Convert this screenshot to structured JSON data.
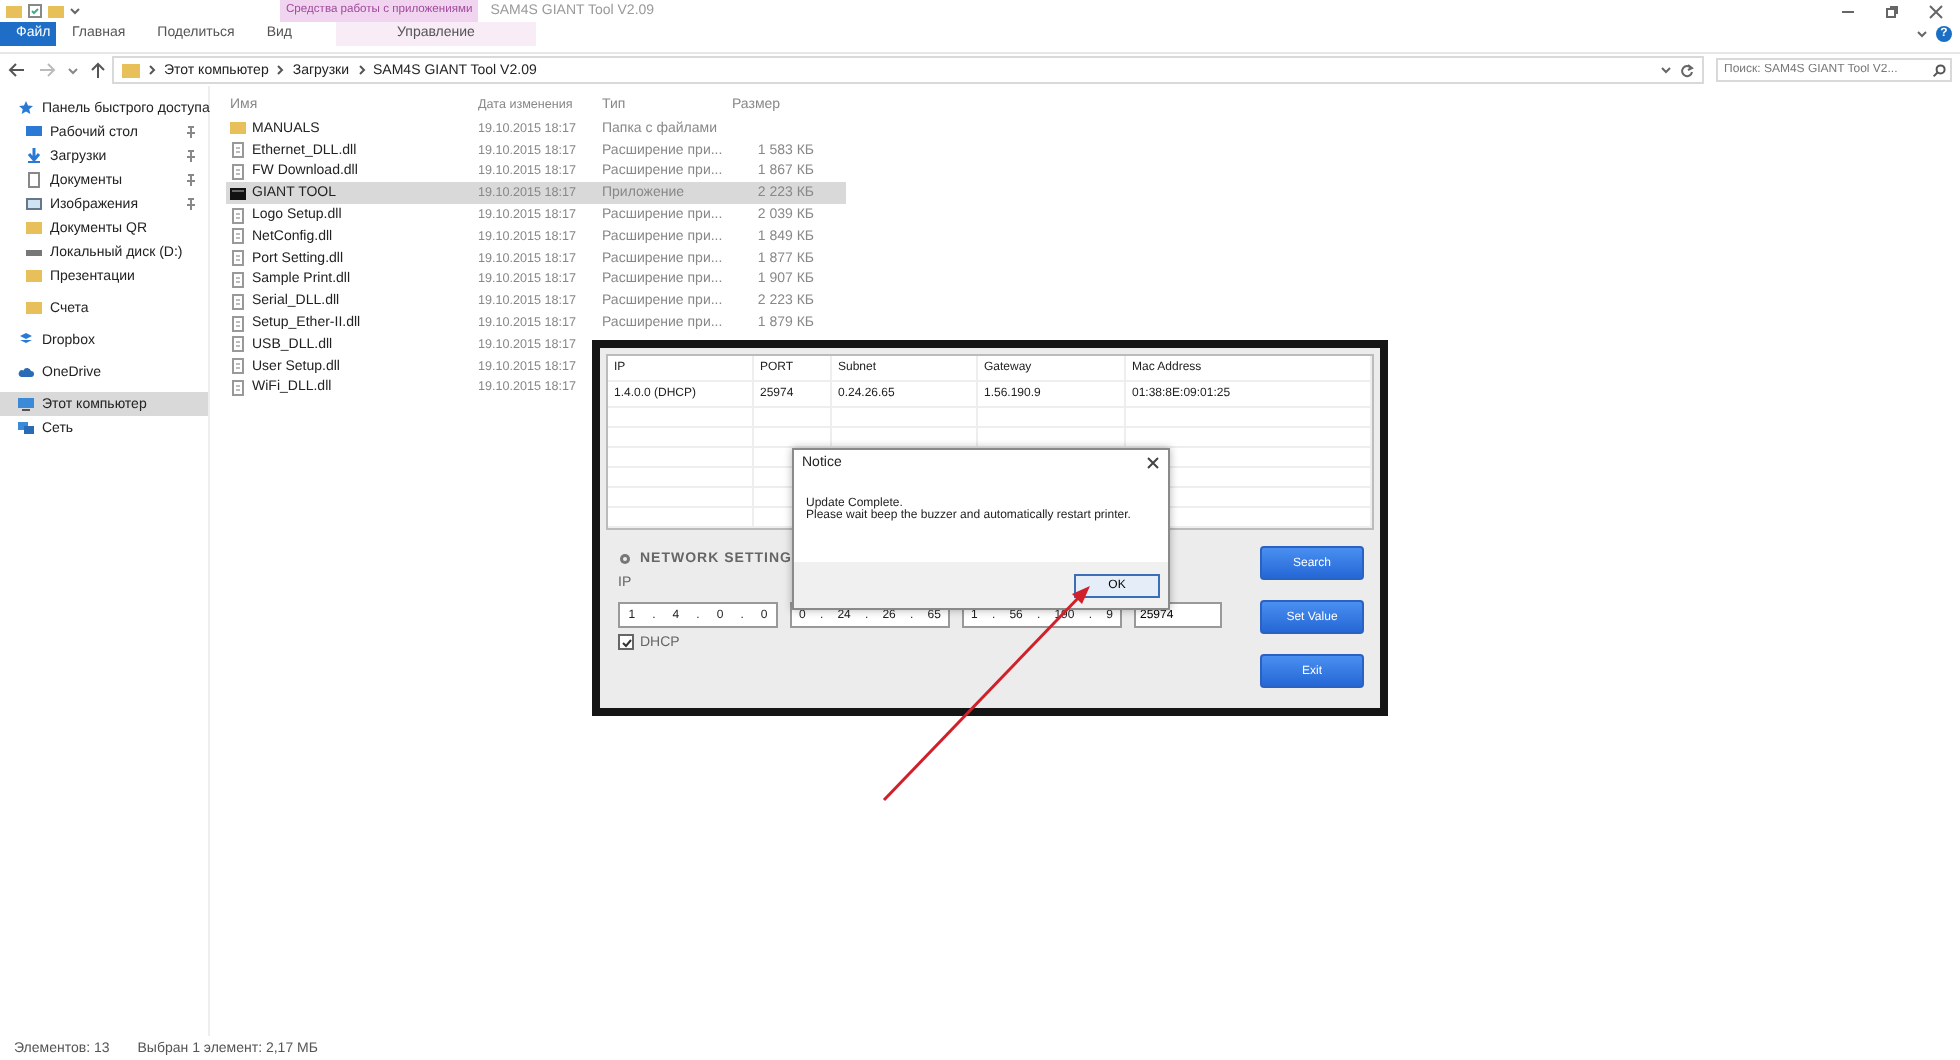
{
  "explorer": {
    "title": "SAM4S GIANT Tool V2.09",
    "context_label": "Средства работы с приложениями",
    "ribbon_tabs": [
      {
        "label": "Файл",
        "kind": "file"
      },
      {
        "label": "Главная",
        "kind": "tab"
      },
      {
        "label": "Поделиться",
        "kind": "tab"
      },
      {
        "label": "Вид",
        "kind": "tab"
      },
      {
        "label": "Управление",
        "kind": "context"
      }
    ],
    "help_glyph": "?",
    "breadcrumbs": [
      "Этот компьютер",
      "Загрузки",
      "SAM4S GIANT Tool V2.09"
    ],
    "search": {
      "placeholder": "Поиск: SAM4S GIANT Tool V2..."
    },
    "sidebar": {
      "items": [
        {
          "label": "Панель быстрого доступа",
          "kind": "star",
          "pinned": false,
          "selected": false,
          "children": [
            {
              "label": "Рабочий стол",
              "kind": "desktop",
              "pinned": true,
              "selected": false
            },
            {
              "label": "Загрузки",
              "kind": "download",
              "pinned": true,
              "selected": false
            },
            {
              "label": "Документы",
              "kind": "document",
              "pinned": true,
              "selected": false
            },
            {
              "label": "Изображения",
              "kind": "picture",
              "pinned": true,
              "selected": false
            },
            {
              "label": "Документы QR",
              "kind": "folder",
              "pinned": false,
              "selected": false
            },
            {
              "label": "Локальный диск (D:)",
              "kind": "drive",
              "pinned": false,
              "selected": false
            },
            {
              "label": "Презентации",
              "kind": "folder",
              "pinned": false,
              "selected": false
            },
            {
              "label": "Счета",
              "kind": "folder",
              "pinned": false,
              "selected": false
            }
          ]
        },
        {
          "label": "Dropbox",
          "kind": "box",
          "pinned": false,
          "selected": false
        },
        {
          "label": "OneDrive",
          "kind": "cloud",
          "pinned": false,
          "selected": false
        },
        {
          "label": "Этот компьютер",
          "kind": "computer",
          "pinned": false,
          "selected": true
        },
        {
          "label": "Сеть",
          "kind": "network",
          "pinned": false,
          "selected": false
        }
      ]
    },
    "columns": [
      "Имя",
      "Дата изменения",
      "Тип",
      "Размер"
    ],
    "rows": [
      {
        "name": "MANUALS",
        "kind": "folder",
        "date": "19.10.2015 18:17",
        "type": "Папка с файлами",
        "selected": false
      },
      {
        "name": "Ethernet_DLL.dll",
        "kind": "dll",
        "date": "19.10.2015 18:17",
        "type": "Расширение при...",
        "size": "1 583 КБ",
        "selected": false
      },
      {
        "name": "FW Download.dll",
        "kind": "dll",
        "date": "19.10.2015 18:17",
        "type": "Расширение при...",
        "size": "1 867 КБ",
        "selected": false
      },
      {
        "name": "GIANT TOOL",
        "kind": "app",
        "date": "19.10.2015 18:17",
        "type": "Приложение",
        "size": "2 223 КБ",
        "selected": true
      },
      {
        "name": "Logo Setup.dll",
        "kind": "dll",
        "date": "19.10.2015 18:17",
        "type": "Расширение при...",
        "size": "2 039 КБ",
        "selected": false
      },
      {
        "name": "NetConfig.dll",
        "kind": "dll",
        "date": "19.10.2015 18:17",
        "type": "Расширение при...",
        "size": "1 849 КБ",
        "selected": false
      },
      {
        "name": "Port Setting.dll",
        "kind": "dll",
        "date": "19.10.2015 18:17",
        "type": "Расширение при...",
        "size": "1 877 КБ",
        "selected": false
      },
      {
        "name": "Sample Print.dll",
        "kind": "dll",
        "date": "19.10.2015 18:17",
        "type": "Расширение при...",
        "size": "1 907 КБ",
        "selected": false
      },
      {
        "name": "Serial_DLL.dll",
        "kind": "dll",
        "date": "19.10.2015 18:17",
        "type": "Расширение при...",
        "size": "2 223 КБ",
        "selected": false
      },
      {
        "name": "Setup_Ether-II.dll",
        "kind": "dll",
        "date": "19.10.2015 18:17",
        "type": "Расширение при...",
        "size": "1 879 КБ",
        "selected": false
      },
      {
        "name": "USB_DLL.dll",
        "kind": "dll",
        "date": "19.10.2015 18:17",
        "selected": false
      },
      {
        "name": "User Setup.dll",
        "kind": "dll",
        "date": "19.10.2015 18:17",
        "selected": false
      },
      {
        "name": "WiFi_DLL.dll",
        "kind": "dll",
        "date": "19.10.2015 18:17",
        "selected": false
      }
    ],
    "status_bar": [
      "Элементов: 13",
      "Выбран 1 элемент: 2,17 МБ"
    ]
  },
  "tool": {
    "table": {
      "columns": [
        "IP",
        "PORT",
        "Subnet",
        "Gateway",
        "Mac Address"
      ],
      "rows": [
        [
          "1.4.0.0 (DHCP)",
          "25974",
          "0.24.26.65",
          "1.56.190.9",
          "01:38:8E:09:01:25"
        ]
      ]
    },
    "section_title": "NETWORK SETTING",
    "ip_label": "IP",
    "separator": ".",
    "ip": [
      "1",
      "4",
      "0",
      "0"
    ],
    "subnet": [
      "0",
      "24",
      "26",
      "65"
    ],
    "gateway": [
      "1",
      "56",
      "190",
      "9"
    ],
    "port": "25974",
    "dhcp": {
      "label": "DHCP",
      "checked": true
    },
    "buttons": [
      "Search",
      "Set Value",
      "Exit"
    ]
  },
  "dialog": {
    "title": "Notice",
    "message": [
      "Update Complete.",
      "Please wait beep the buzzer and automatically restart printer."
    ],
    "button": "OK"
  }
}
